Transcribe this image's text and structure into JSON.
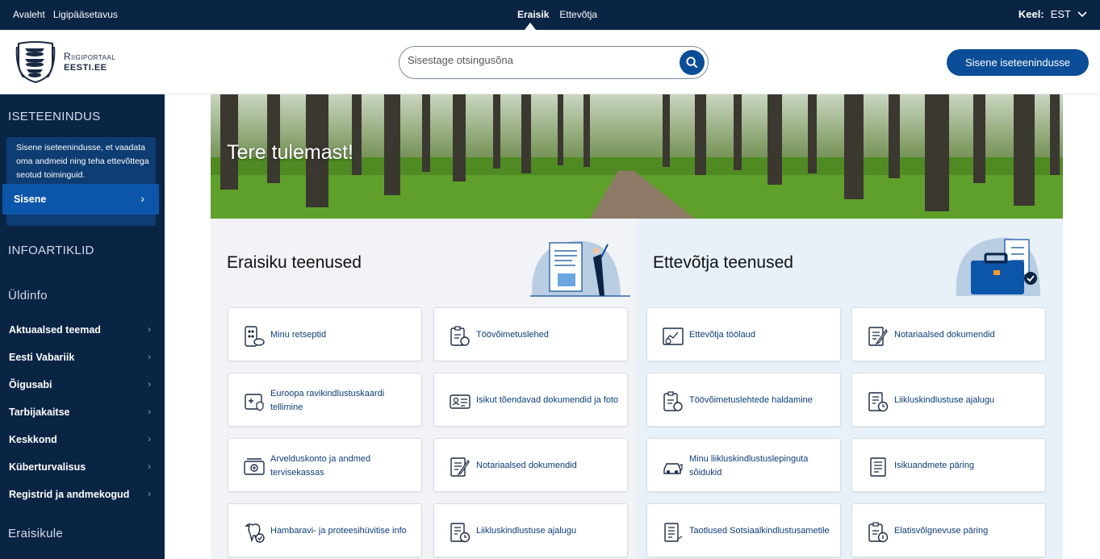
{
  "topbar": {
    "left_links": [
      "Avaleht",
      "Ligipääsetavus"
    ],
    "tabs": [
      {
        "label": "Eraisik",
        "active": true
      },
      {
        "label": "Ettevõtja",
        "active": false
      }
    ],
    "lang_label": "Keel:",
    "lang_value": "EST"
  },
  "header": {
    "logo_line1": "Riigiportaal",
    "logo_line2": "EESTI.EE",
    "search_placeholder": "Sisestage otsingusõna",
    "login_button": "Sisene iseteenindusse"
  },
  "sidebar": {
    "self_service_heading": "ISETEENINDUS",
    "self_service_text": "Sisene iseteenindusse, et vaadata oma andmeid ning teha ettevõttega seotud toiminguid.",
    "enter_button": "Sisene",
    "info_heading": "INFOARTIKLID",
    "general_heading": "Üldinfo",
    "links": [
      "Aktuaalsed teemad",
      "Eesti Vabariik",
      "Õigusabi",
      "Tarbijakaitse",
      "Keskkond",
      "Küberturvalisus",
      "Registrid ja andmekogud"
    ],
    "bottom_heading": "Eraisikule"
  },
  "hero": {
    "title": "Tere tulemast!"
  },
  "private": {
    "heading": "Eraisiku teenused",
    "cards": [
      {
        "label": "Minu retseptid",
        "icon": "prescription-icon"
      },
      {
        "label": "Töövõimetuslehed",
        "icon": "sick-leave-icon"
      },
      {
        "label": "Euroopa ravikindlustuskaardi tellimine",
        "icon": "health-card-icon"
      },
      {
        "label": "Isikut tõendavad dokumendid ja foto",
        "icon": "id-card-icon"
      },
      {
        "label": "Arvelduskonto ja andmed tervisekassas",
        "icon": "bank-account-icon"
      },
      {
        "label": "Notariaalsed dokumendid",
        "icon": "notary-document-icon"
      },
      {
        "label": "Hambaravi- ja proteesihüvitise info",
        "icon": "tooth-icon"
      },
      {
        "label": "Liikluskindlustuse ajalugu",
        "icon": "insurance-history-icon"
      }
    ]
  },
  "business": {
    "heading": "Ettevõtja teenused",
    "cards": [
      {
        "label": "Ettevõtja töölaud",
        "icon": "dashboard-icon"
      },
      {
        "label": "Notariaalsed dokumendid",
        "icon": "notary-document-icon"
      },
      {
        "label": "Töövõimetuslehtede haldamine",
        "icon": "sick-leave-icon"
      },
      {
        "label": "Liikluskindlustuse ajalugu",
        "icon": "insurance-history-icon"
      },
      {
        "label": "Minu liikluskindlustuslepinguta sõidukid",
        "icon": "car-icon"
      },
      {
        "label": "Isikuandmete päring",
        "icon": "personal-data-icon"
      },
      {
        "label": "Taotlused Sotsiaalkindlustusametile",
        "icon": "application-icon"
      },
      {
        "label": "Elatisvõlgnevuse päring",
        "icon": "alimony-icon"
      }
    ]
  },
  "colors": {
    "navy": "#0a2444",
    "primary": "#0b4d97",
    "link": "#0d3d78"
  }
}
